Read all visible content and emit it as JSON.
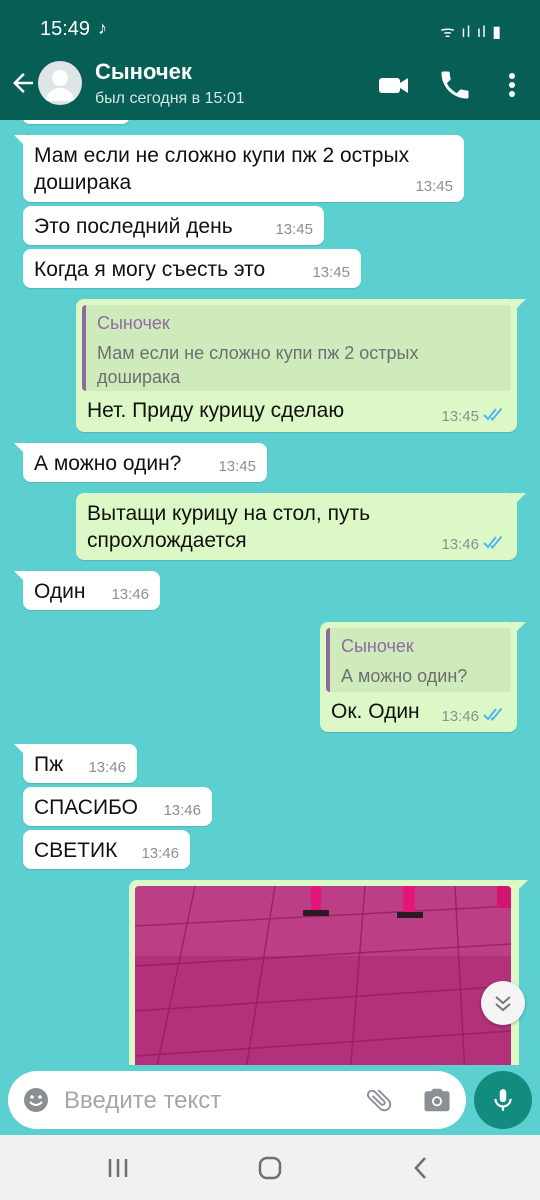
{
  "status": {
    "time": "15:49",
    "note_icon": "music-note-icon",
    "signal_text": "ᯤ ıl ıl ▮"
  },
  "header": {
    "name": "Сыночек",
    "last_seen": "был сегодня в 15:01"
  },
  "messages": [
    {
      "dir": "in",
      "text": "Мам если не сложно купи пж 2 острых\nдоширака",
      "time": "13:45"
    },
    {
      "dir": "in",
      "text": "Это последний день",
      "time": "13:45"
    },
    {
      "dir": "in",
      "text": "Когда я могу съесть это",
      "time": "13:45"
    },
    {
      "dir": "out",
      "reply_name": "Сыночек",
      "reply_text": "Мам если не сложно купи пж 2 острых\nдоширака",
      "text": "Нет. Приду курицу сделаю",
      "time": "13:45"
    },
    {
      "dir": "in",
      "text": "А можно один?",
      "time": "13:45"
    },
    {
      "dir": "out",
      "text": "Вытащи курицу на стол, путь\nспрохлождается",
      "time": "13:46"
    },
    {
      "dir": "in",
      "text": "Один",
      "time": "13:46"
    },
    {
      "dir": "out",
      "reply_name": "Сыночек",
      "reply_text": "А можно один?",
      "text": "Ок. Один",
      "time": "13:46"
    },
    {
      "dir": "in",
      "text": "Пж",
      "time": "13:46"
    },
    {
      "dir": "in",
      "text": "СПАСИБО",
      "time": "13:46"
    },
    {
      "dir": "in",
      "text": "СВЕТИК",
      "time": "13:46"
    }
  ],
  "composer": {
    "placeholder": "Введите текст"
  },
  "colors": {
    "header": "#075e54",
    "chat_bg": "#5ccfd1",
    "outgoing": "#dcf8c6",
    "incoming": "#ffffff",
    "accent": "#128c7e",
    "ticks": "#4fb6ec"
  }
}
